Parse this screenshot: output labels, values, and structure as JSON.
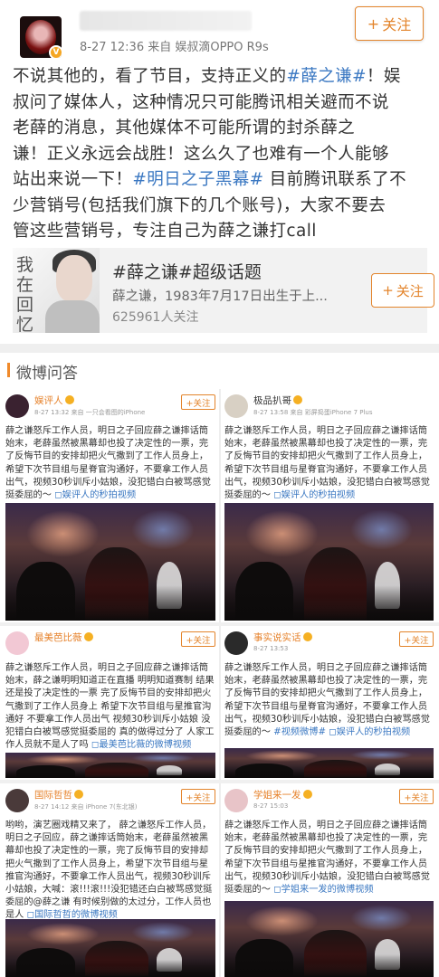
{
  "post": {
    "meta": "8-27 12:36  来自 娱叔滴OPPO R9s",
    "follow_label": "关注",
    "lines": [
      [
        {
          "t": "不说其他的，看了节目，支持正义的"
        },
        {
          "t": "#薛之谦#",
          "tag": true
        },
        {
          "t": "！娱"
        }
      ],
      [
        {
          "t": "叔问了媒体人，这种情况只可能腾讯相关避而不说"
        }
      ],
      [
        {
          "t": "老薛的消息，其他媒体不可能所谓的封杀薛之"
        }
      ],
      [
        {
          "t": "谦！正义永远会战胜！这么久了也难有一个人能够"
        }
      ],
      [
        {
          "t": "站出来说一下！"
        },
        {
          "t": "#明日之子黑幕#",
          "tag": true
        },
        {
          "t": " 目前腾讯联系了不"
        }
      ],
      [
        {
          "t": "少营销号(包括我们旗下的几个账号)，大家不要去"
        }
      ],
      [
        {
          "t": "管这些营销号，专注自己为薛之谦打call"
        }
      ]
    ]
  },
  "topic": {
    "cover_text": "我在回忆里过你",
    "title": "#薛之谦#超级话题",
    "desc": "薛之谦，1983年7月17日出生于上...",
    "count": "625961人关注",
    "follow_label": "关注"
  },
  "section": {
    "title": "微博问答"
  },
  "cards": [
    {
      "name": "娱评人",
      "name_color": "orange",
      "avatar_color": "#3a2230",
      "meta": "8-27 13:32  来自 一只会看图的iPhone",
      "follow_label": "+关注",
      "text": "薛之谦怒斥工作人员，明日之子回应薛之谦摔话筒始末，老薛虽然被黑幕却也投了决定性的一票，完了反悔节目的安排却把火气撒到了工作人员身上，希望下次节目组与星脊官沟通好，不要拿工作人员出气，视频30秒训斥小姑娘，没犯错白白被骂感觉挺委屈的～",
      "link": "◻娱评人的秒拍视频"
    },
    {
      "name": "极品扒哥",
      "name_color": "gray",
      "avatar_color": "#d8d0c4",
      "meta": "8-27 13:58  来自 彩屏捣蛋iPhone 7 Plus",
      "follow_label": "",
      "text": "薛之谦怒斥工作人员，明日之子回应薛之谦摔话筒始末，老薛虽然被黑幕却也投了决定性的一票，完了反悔节目的安排却把火气撒到了工作人员身上，希望下次节目组与星脊官沟通好，不要拿工作人员出气，视频30秒训斥小姑娘，没犯错白白被骂感觉挺委屈的～",
      "link": "◻娱评人的秒拍视频"
    },
    {
      "name": "最美芭比薇",
      "name_color": "orange",
      "avatar_color": "#f2c8d4",
      "meta": "",
      "follow_label": "+关注",
      "text": "薛之谦怒斥工作人员，明日之子回应薛之谦摔话筒始末，薛之谦明明知道正在直播 明明知道赛制 结果还是投了决定性的一票 完了反悔节目的安排却把火气撒到了工作人员身上 希望下次节目组与星推官沟通好 不要拿工作人员出气 视频30秒训斥小姑娘 没犯错白白被骂感觉挺委屈的 真的做得过分了 人家工作人员就不是人了吗",
      "link": "◻最美芭比薇的微博视频"
    },
    {
      "name": "事实说实话",
      "name_color": "orange",
      "avatar_color": "#2a2a2a",
      "meta": "8-27 13:53",
      "follow_label": "+关注",
      "text": "薛之谦怒斥工作人员，明日之子回应薛之谦摔话筒始末，老薛虽然被黑幕却也投了决定性的一票，完了反悔节目的安排却把火气撒到了工作人员身上，希望下次节目组与星脊官沟通好，不要拿工作人员出气，视频30秒训斥小姑娘，没犯错白白被骂感觉挺委屈的～",
      "link": "#视频微博# ◻娱评人的秒拍视频"
    },
    {
      "name": "国际哲哲",
      "name_color": "orange",
      "avatar_color": "#4a3a3a",
      "meta": "8-27 14:12  来自 iPhone 7(东北银)",
      "follow_label": "+关注",
      "text": "哟哟，演艺圈戏精又来了， 薛之谦怒斥工作人员，明日之子回应，薛之谦摔话筒始末，老薛虽然被黑幕却也投了决定性的一票，完了反悔节目的安排却把火气撒到了工作人员身上，希望下次节目组与星推官沟通好，不要拿工作人员出气，视频30秒训斥小姑娘，大喊：滚!!!滚!!!没犯错还白白被骂感觉挺委屈的@薛之谦 有时候别做的太过分，工作人员也是人",
      "link": "◻国际哲哲的微博视频"
    },
    {
      "name": "学姐来一发",
      "name_color": "orange",
      "avatar_color": "#e8c4c8",
      "meta": "8-27 15:03",
      "follow_label": "+关注",
      "text": "薛之谦怒斥工作人员，明日之子回应薛之谦摔话筒始末，老薛虽然被黑幕却也投了决定性的一票，完了反悔节目的安排却把火气撒到了工作人员身上，希望下次节目组与星推官沟通好，不要拿工作人员出气，视频30秒训斥小姑娘，没犯错白白被骂感觉挺委屈的～",
      "link": "◻学姐来一发的微博视频"
    }
  ]
}
